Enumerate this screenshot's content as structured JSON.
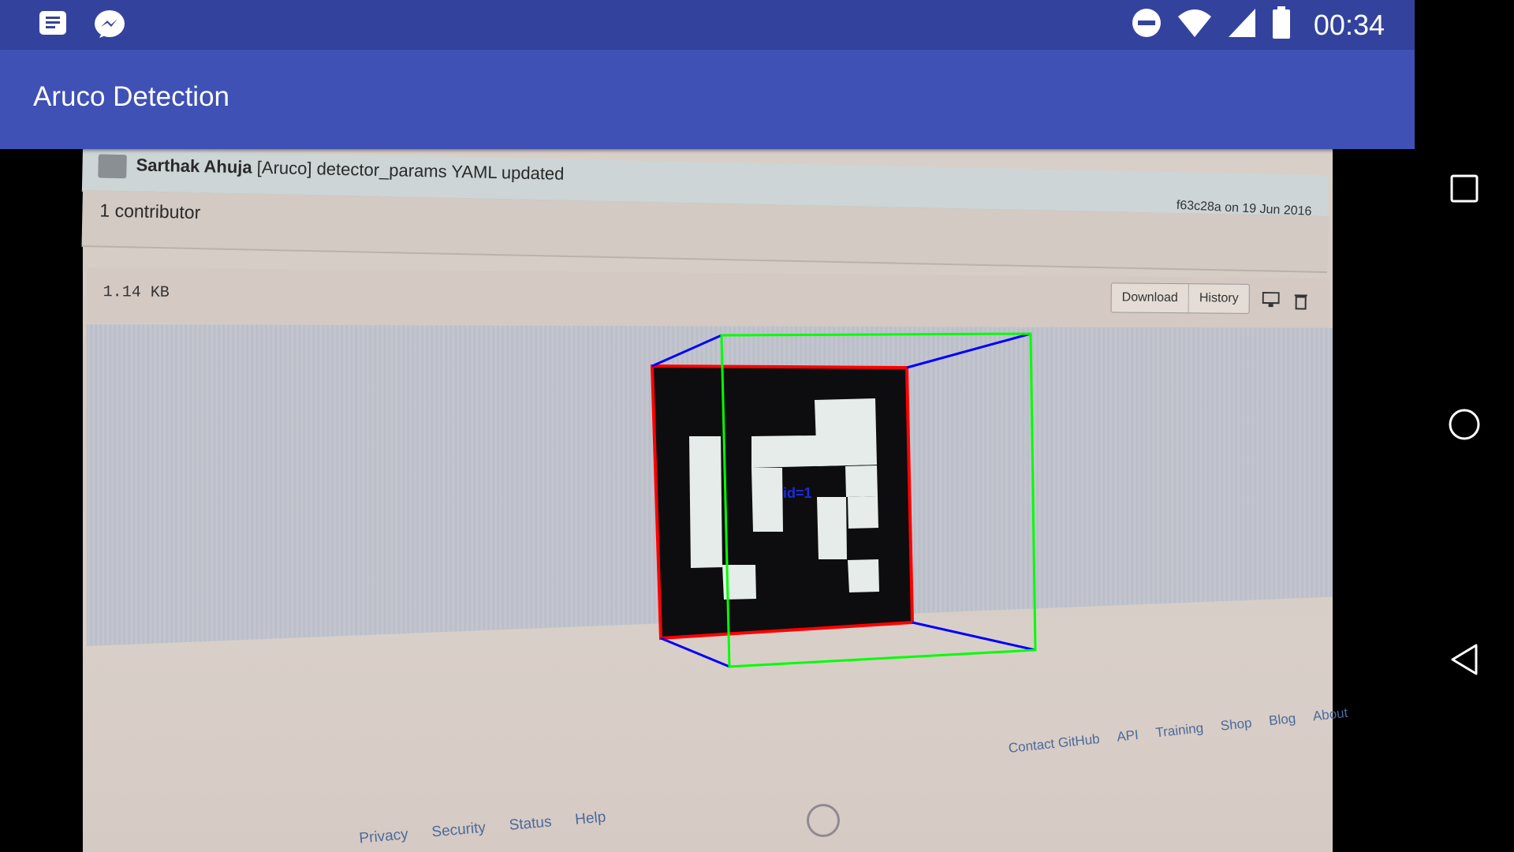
{
  "app": {
    "title": "Aruco Detection"
  },
  "status_bar": {
    "clock": "00:34",
    "left_icons": [
      "notes-icon",
      "messenger-icon"
    ],
    "right_icons": [
      "do-not-disturb-icon",
      "wifi-icon",
      "signal-icon",
      "battery-icon"
    ]
  },
  "nav_bar": {
    "icons": [
      "recents-icon",
      "home-icon",
      "back-icon"
    ]
  },
  "photo": {
    "commit": {
      "author": "Sarthak Ahuja",
      "message": "[Aruco] detector_params YAML updated",
      "hash": "f63c28a on 19 Jun 2016"
    },
    "contributors": "1 contributor",
    "file_size": "1.14 KB",
    "buttons": [
      "Download",
      "History"
    ],
    "footer_right": [
      "Contact GitHub",
      "API",
      "Training",
      "Shop",
      "Blog",
      "About"
    ],
    "footer_left": [
      "Privacy",
      "Security",
      "Status",
      "Help"
    ]
  },
  "marker": {
    "label": "id=1",
    "id": 1
  },
  "colors": {
    "status_bar": "#33439d",
    "app_bar": "#3f51b5",
    "marker_outline": "#ff0000",
    "axis_green": "#00ff00",
    "axis_blue": "#0000ff"
  }
}
